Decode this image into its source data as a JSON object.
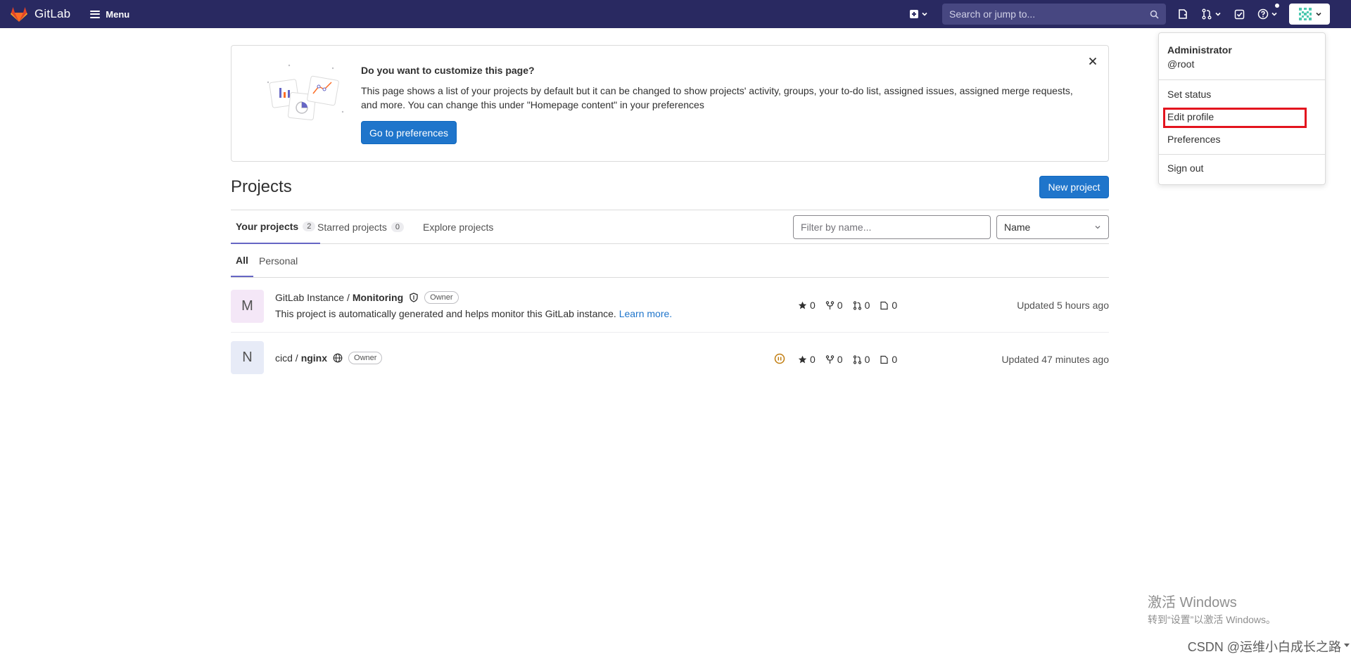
{
  "navbar": {
    "brand": "GitLab",
    "menu_label": "Menu",
    "search_placeholder": "Search or jump to..."
  },
  "banner": {
    "title": "Do you want to customize this page?",
    "text": "This page shows a list of your projects by default but it can be changed to show projects' activity, groups, your to-do list, assigned issues, assigned merge requests, and more. You can change this under \"Homepage content\" in your preferences",
    "button": "Go to preferences"
  },
  "page": {
    "title": "Projects",
    "new_project": "New project"
  },
  "tabs": [
    {
      "label": "Your projects",
      "count": "2"
    },
    {
      "label": "Starred projects",
      "count": "0"
    },
    {
      "label": "Explore projects"
    }
  ],
  "filter": {
    "placeholder": "Filter by name...",
    "sort_value": "Name"
  },
  "subtabs": [
    "All",
    "Personal"
  ],
  "projects": [
    {
      "initial": "M",
      "namespace": "GitLab Instance / ",
      "name": "Monitoring",
      "visibility_icon": "shield-icon",
      "role": "Owner",
      "description": "This project is automatically generated and helps monitor this GitLab instance.",
      "learn_more": "Learn more.",
      "stars": "0",
      "forks": "0",
      "merge_requests": "0",
      "issues": "0",
      "updated": "Updated 5 hours ago",
      "avatar_color": "#f4e7f7"
    },
    {
      "initial": "N",
      "namespace": "cicd / ",
      "name": "nginx",
      "visibility_icon": "globe-icon",
      "role": "Owner",
      "stars": "0",
      "forks": "0",
      "merge_requests": "0",
      "issues": "0",
      "updated": "Updated 47 minutes ago",
      "avatar_color": "#e7ebf7",
      "pipeline_status": "paused"
    }
  ],
  "user_dropdown": {
    "name": "Administrator",
    "username": "@root",
    "items": [
      "Set status",
      "Edit profile",
      "Preferences",
      "Sign out"
    ],
    "highlighted": "Edit profile"
  },
  "watermark": {
    "activate_title": "激活 Windows",
    "activate_sub": "转到“设置”以激活 Windows。",
    "csdn": "CSDN @运维小白成长之路"
  },
  "colors": {
    "navbar": "#292961",
    "primary": "#1f75cb",
    "tab_active": "#6666c4",
    "highlight": "#e3141e"
  }
}
